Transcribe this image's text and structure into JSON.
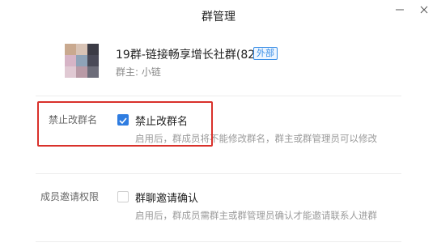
{
  "window": {
    "title": "群管理"
  },
  "group": {
    "name": "19群-链接畅享增长社群(82)",
    "tag": "外部",
    "owner": "群主:  小链",
    "avatar_colors": [
      "#c9a98f",
      "#d8c3b5",
      "#3c3c46",
      "#d6b4c6",
      "#8fa3b8",
      "#4a4a58",
      "#e0c9d3",
      "#b99aa6",
      "#6d6d7a"
    ]
  },
  "settings": [
    {
      "section_label": "禁止改群名",
      "checkbox_label": "禁止改群名",
      "checked": true,
      "description": "启用后，群成员将不能修改群名，群主或群管理员可以修改"
    },
    {
      "section_label": "成员邀请权限",
      "checkbox_label": "群聊邀请确认",
      "checked": false,
      "description": "启用后，群成员需群主或群管理员确认才能邀请联系人进群"
    }
  ],
  "colors": {
    "accent": "#2f7de1",
    "highlight": "#d9312b"
  }
}
